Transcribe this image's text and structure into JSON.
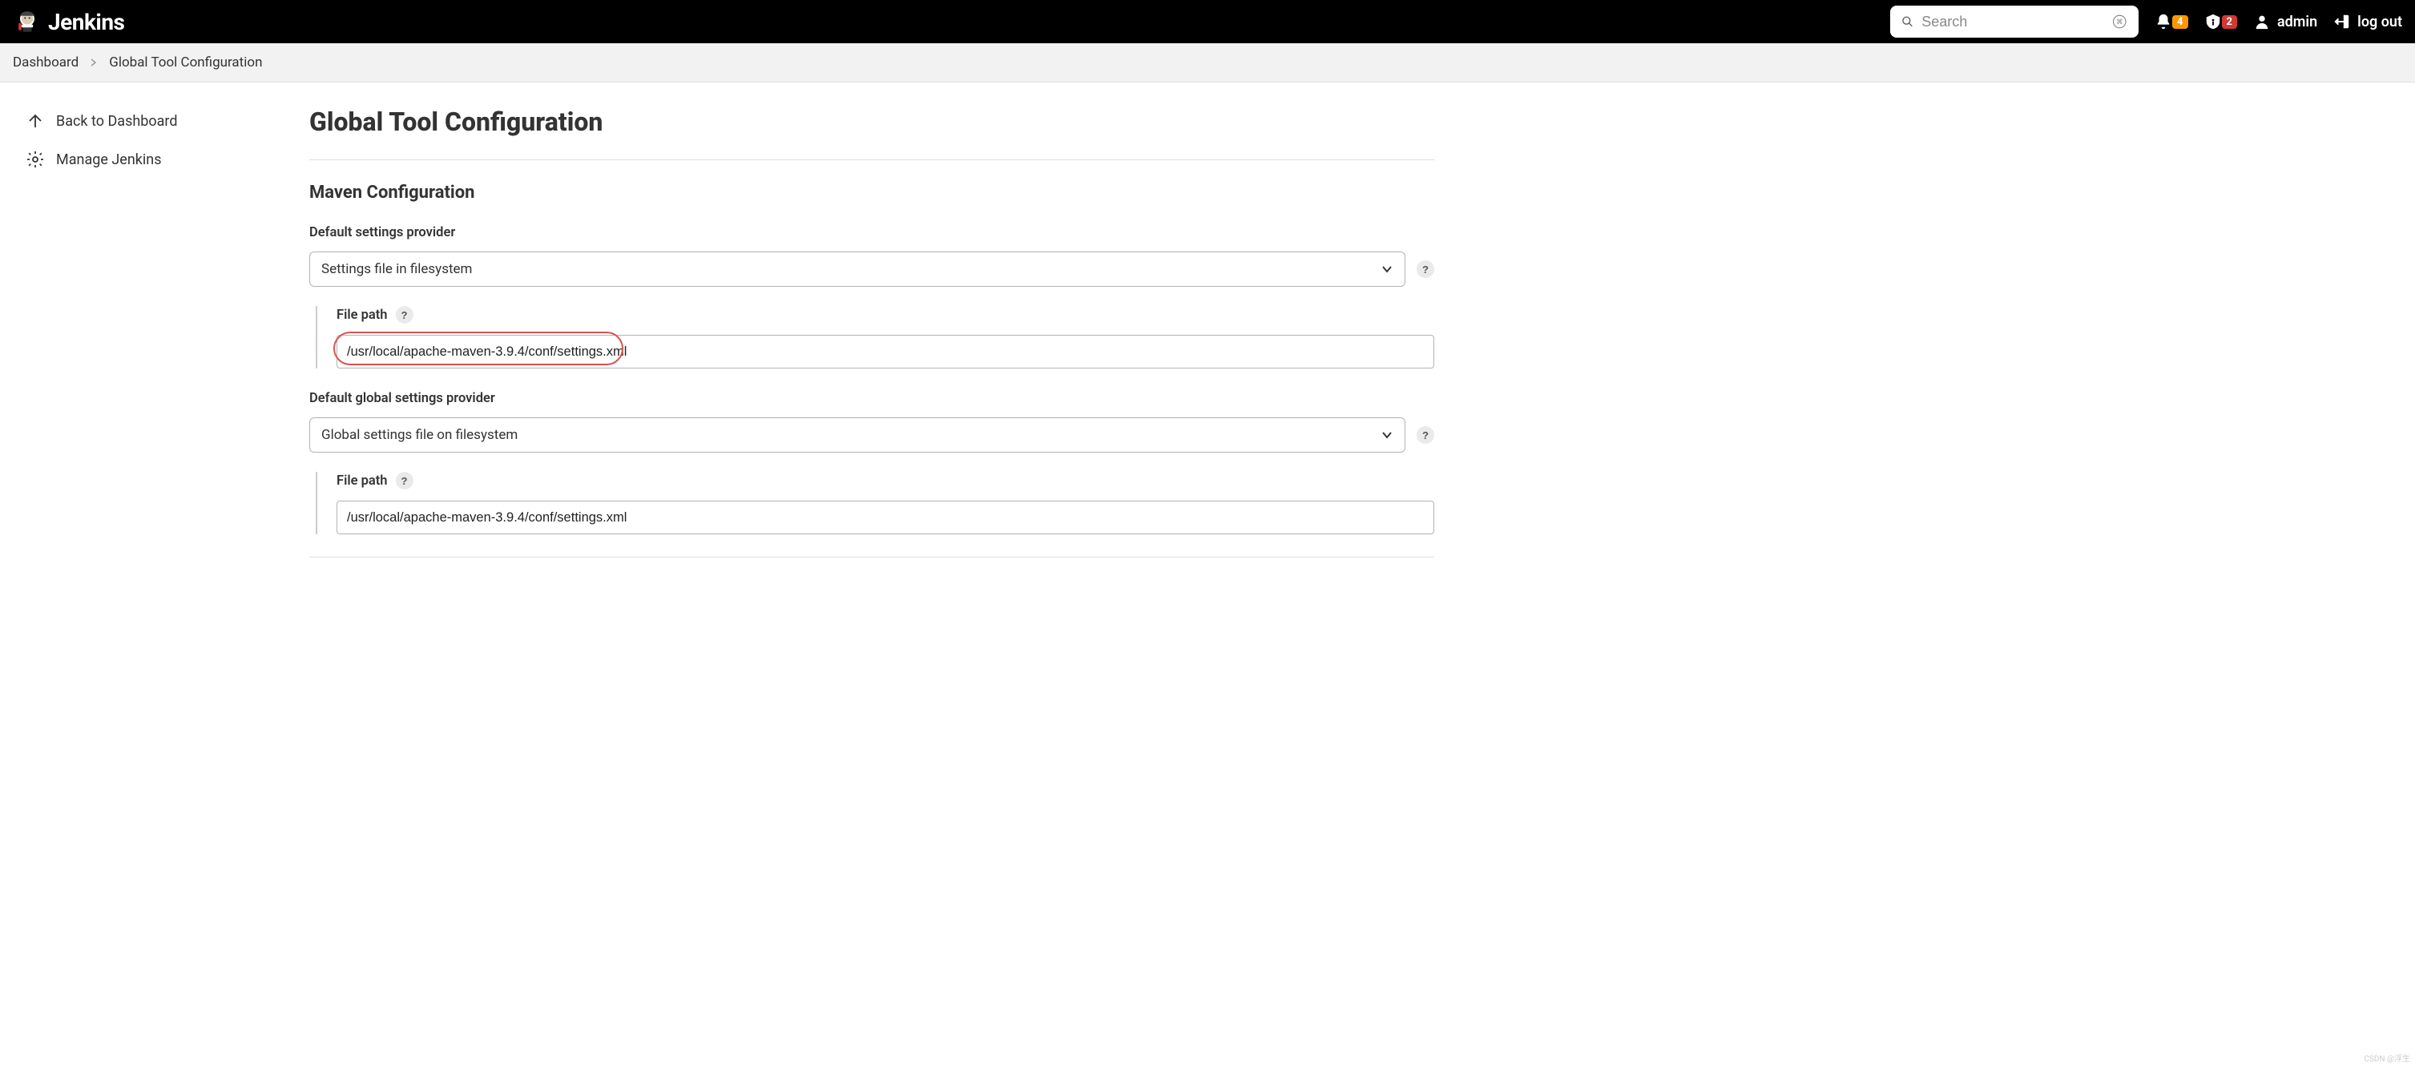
{
  "header": {
    "brand": "Jenkins",
    "search_placeholder": "Search",
    "notifications_count": "4",
    "alerts_count": "2",
    "user_name": "admin",
    "logout_label": "log out"
  },
  "breadcrumb": {
    "items": [
      {
        "label": "Dashboard"
      },
      {
        "label": "Global Tool Configuration"
      }
    ]
  },
  "sidebar": {
    "items": [
      {
        "label": "Back to Dashboard",
        "icon": "arrow-up-icon"
      },
      {
        "label": "Manage Jenkins",
        "icon": "gear-icon"
      }
    ]
  },
  "main": {
    "title": "Global Tool Configuration",
    "section_title": "Maven Configuration",
    "default_settings": {
      "label": "Default settings provider",
      "selected": "Settings file in filesystem",
      "file_path_label": "File path",
      "file_path_value": "/usr/local/apache-maven-3.9.4/conf/settings.xml"
    },
    "default_global_settings": {
      "label": "Default global settings provider",
      "selected": "Global settings file on filesystem",
      "file_path_label": "File path",
      "file_path_value": "/usr/local/apache-maven-3.9.4/conf/settings.xml"
    },
    "help_char": "?"
  },
  "watermark": "CSDN @浮生"
}
